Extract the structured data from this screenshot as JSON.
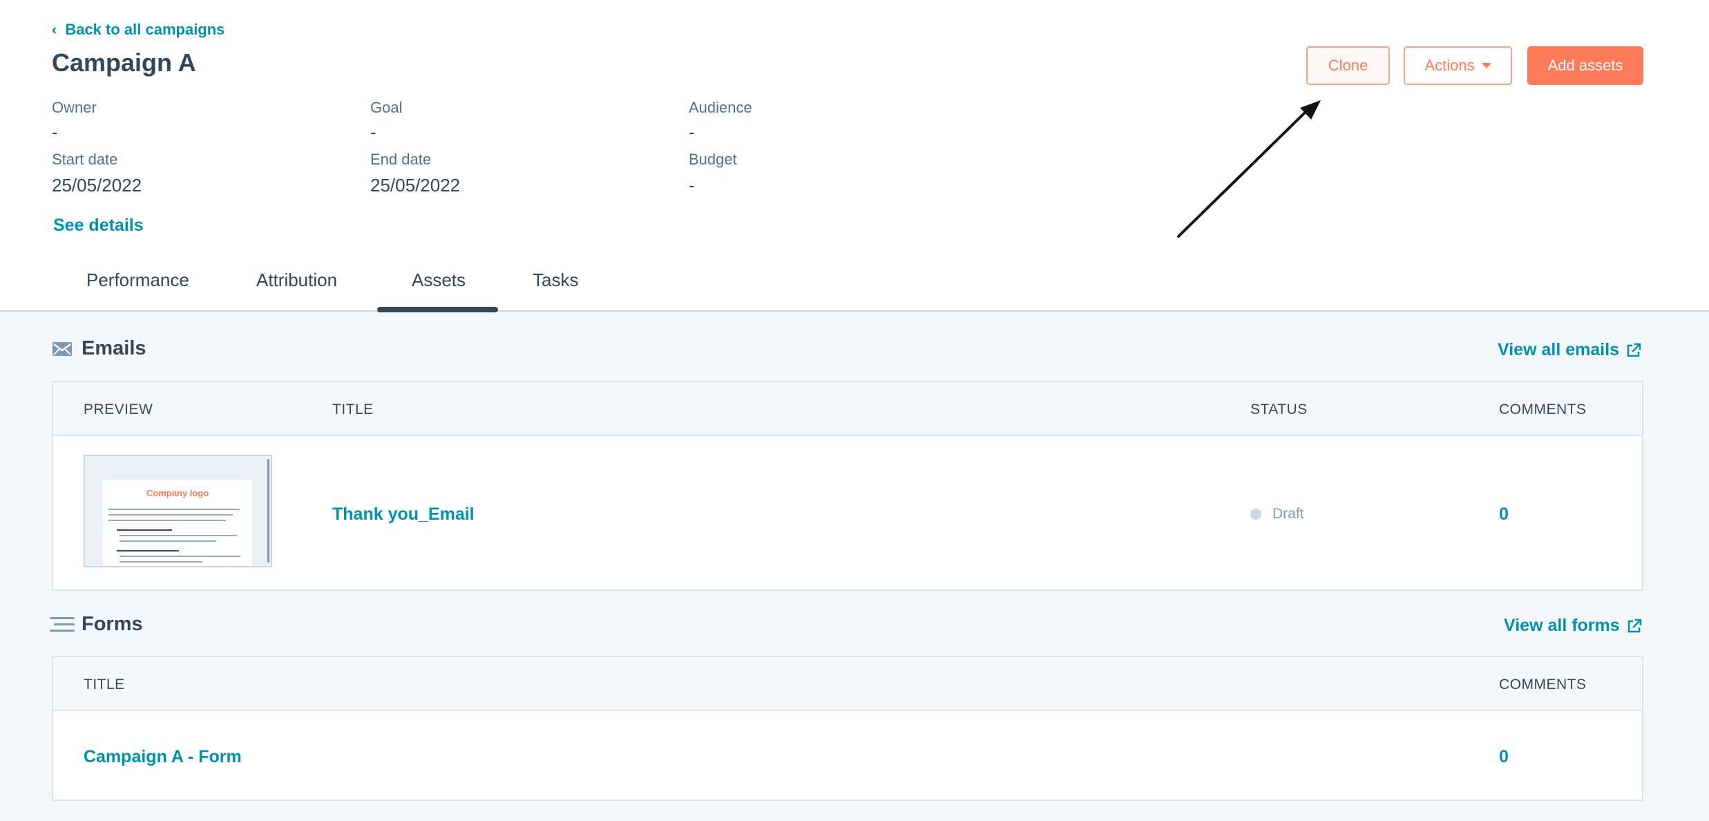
{
  "header": {
    "back_link": "Back to all campaigns",
    "title": "Campaign A",
    "buttons": {
      "clone": "Clone",
      "actions": "Actions",
      "add_assets": "Add assets"
    }
  },
  "details": {
    "owner": {
      "label": "Owner",
      "value": "-"
    },
    "goal": {
      "label": "Goal",
      "value": "-"
    },
    "audience": {
      "label": "Audience",
      "value": "-"
    },
    "start_date": {
      "label": "Start date",
      "value": "25/05/2022"
    },
    "end_date": {
      "label": "End date",
      "value": "25/05/2022"
    },
    "budget": {
      "label": "Budget",
      "value": "-"
    },
    "see_details": "See details"
  },
  "tabs": [
    {
      "label": "Performance"
    },
    {
      "label": "Attribution"
    },
    {
      "label": "Assets",
      "active": true
    },
    {
      "label": "Tasks"
    }
  ],
  "emails": {
    "title": "Emails",
    "view_all": "View all emails",
    "columns": [
      "PREVIEW",
      "TITLE",
      "STATUS",
      "COMMENTS"
    ],
    "rows": [
      {
        "preview_logo": "Company logo",
        "title": "Thank you_Email",
        "status": "Draft",
        "comments": "0"
      }
    ]
  },
  "forms": {
    "title": "Forms",
    "view_all": "View all forms",
    "columns": [
      "TITLE",
      "COMMENTS"
    ],
    "rows": [
      {
        "title": "Campaign A - Form",
        "comments": "0"
      }
    ]
  },
  "icons": {
    "back": "chevron-left-icon",
    "emails": "envelope-icon",
    "forms": "form-lines-icon",
    "external": "external-link-icon",
    "annotation": "arrow-annotation-icon"
  },
  "colors": {
    "link": "#0091ae",
    "primary": "#ff7a59",
    "text": "#33475b",
    "muted": "#516f90",
    "background": "#f5f8fa"
  }
}
